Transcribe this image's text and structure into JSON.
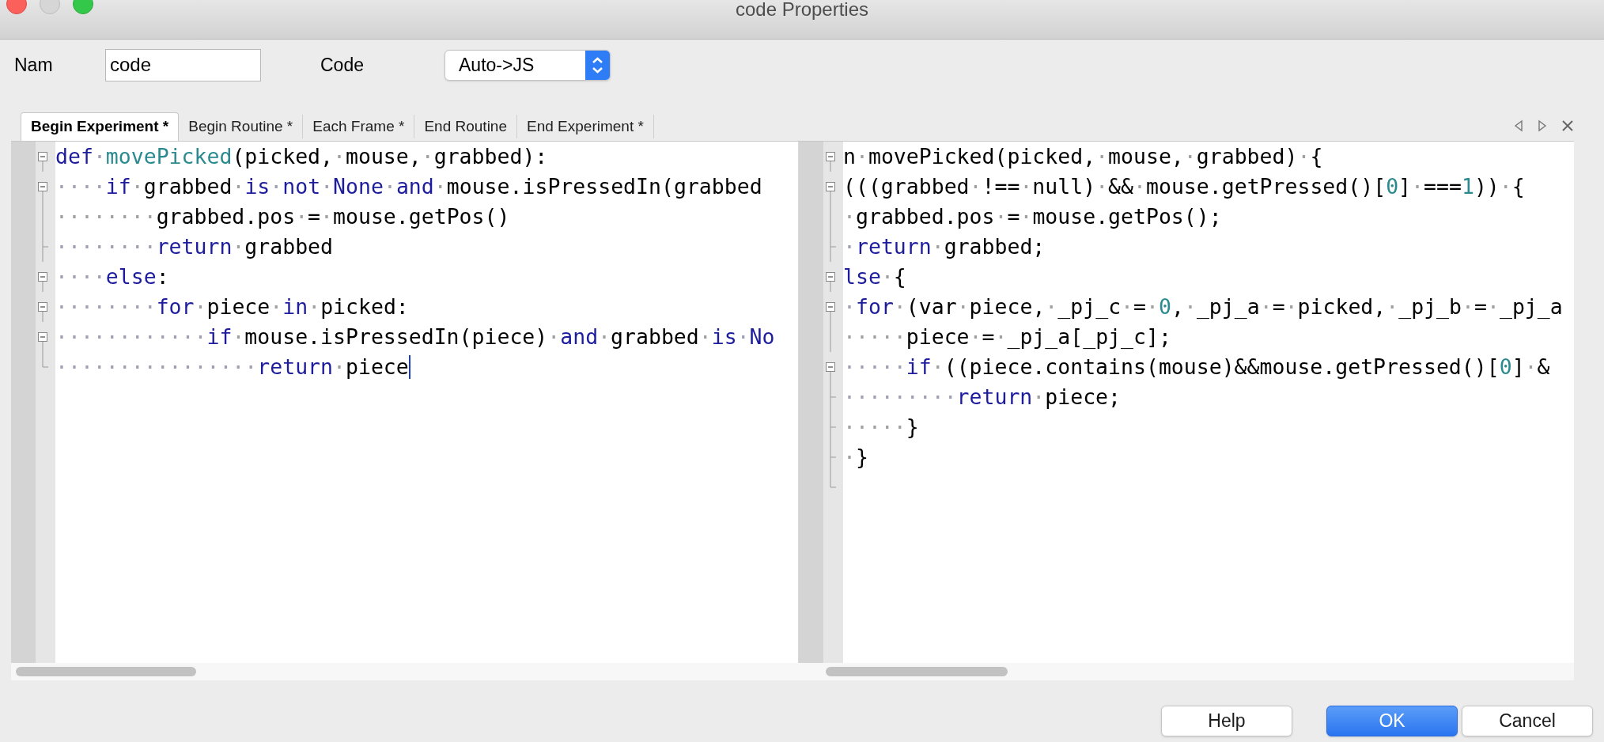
{
  "window": {
    "title": "code Properties"
  },
  "name_field": {
    "label": "Nam",
    "value": "code"
  },
  "code_type": {
    "label": "Code",
    "value": "Auto->JS"
  },
  "tabs": [
    {
      "label": "Begin Experiment *",
      "selected": true
    },
    {
      "label": "Begin Routine *",
      "selected": false
    },
    {
      "label": "Each Frame *",
      "selected": false
    },
    {
      "label": "End Routine",
      "selected": false
    },
    {
      "label": "End Experiment *",
      "selected": false
    }
  ],
  "editors": [
    {
      "lines": [
        {
          "kind": "fold-start",
          "caret": false,
          "tokens": [
            {
              "kind": "kw",
              "text": "def·"
            },
            {
              "kind": "fn",
              "text": "movePicked"
            },
            {
              "kind": "txt",
              "text": "(picked,·mouse,·grabbed):"
            }
          ]
        },
        {
          "kind": "fold-start",
          "caret": false,
          "tokens": [
            {
              "kind": "kw",
              "text": "····if"
            },
            {
              "kind": "txt",
              "text": "·grabbed·"
            },
            {
              "kind": "kw",
              "text": "is·not·None·and"
            },
            {
              "kind": "txt",
              "text": "·mouse.isPressedIn(grabbed"
            }
          ]
        },
        {
          "kind": "fold-body",
          "caret": false,
          "tokens": [
            {
              "kind": "txt",
              "text": "········grabbed.pos·=·mouse.getPos()"
            }
          ]
        },
        {
          "kind": "fold-tick",
          "caret": false,
          "tokens": [
            {
              "kind": "kw",
              "text": "········return"
            },
            {
              "kind": "txt",
              "text": "·grabbed"
            }
          ]
        },
        {
          "kind": "fold-start",
          "caret": false,
          "tokens": [
            {
              "kind": "kw",
              "text": "····else"
            },
            {
              "kind": "txt",
              "text": ":"
            }
          ]
        },
        {
          "kind": "fold-start",
          "caret": false,
          "tokens": [
            {
              "kind": "kw",
              "text": "········for"
            },
            {
              "kind": "txt",
              "text": "·piece·"
            },
            {
              "kind": "kw",
              "text": "in"
            },
            {
              "kind": "txt",
              "text": "·picked:"
            }
          ]
        },
        {
          "kind": "fold-start",
          "caret": false,
          "tokens": [
            {
              "kind": "kw",
              "text": "············if"
            },
            {
              "kind": "txt",
              "text": "·mouse.isPressedIn(piece)·"
            },
            {
              "kind": "kw",
              "text": "and"
            },
            {
              "kind": "txt",
              "text": "·grabbed·"
            },
            {
              "kind": "kw",
              "text": "is·No"
            }
          ]
        },
        {
          "kind": "fold-end",
          "caret": true,
          "tokens": [
            {
              "kind": "kw",
              "text": "················return"
            },
            {
              "kind": "txt",
              "text": "·piece"
            }
          ]
        }
      ]
    },
    {
      "lines": [
        {
          "kind": "fold-start",
          "tokens": [
            {
              "kind": "txt",
              "text": "n·movePicked(picked,·mouse,·grabbed)·{"
            }
          ]
        },
        {
          "kind": "fold-start",
          "tokens": [
            {
              "kind": "txt",
              "text": "(((grabbed·!==·null)·&&·mouse.getPressed()["
            },
            {
              "kind": "num",
              "text": "0"
            },
            {
              "kind": "txt",
              "text": "]·==="
            },
            {
              "kind": "num",
              "text": "1"
            },
            {
              "kind": "txt",
              "text": "))·{"
            }
          ]
        },
        {
          "kind": "fold-body",
          "tokens": [
            {
              "kind": "txt",
              "text": "·grabbed.pos·=·mouse.getPos();"
            }
          ]
        },
        {
          "kind": "fold-tick",
          "tokens": [
            {
              "kind": "kw",
              "text": "·return"
            },
            {
              "kind": "txt",
              "text": "·grabbed;"
            }
          ]
        },
        {
          "kind": "fold-start",
          "tokens": [
            {
              "kind": "kw",
              "text": "lse"
            },
            {
              "kind": "txt",
              "text": "·{"
            }
          ]
        },
        {
          "kind": "fold-start",
          "tokens": [
            {
              "kind": "kw",
              "text": "·for"
            },
            {
              "kind": "txt",
              "text": "·(var·piece,·_pj_c·=·"
            },
            {
              "kind": "num",
              "text": "0"
            },
            {
              "kind": "txt",
              "text": ",·_pj_a·=·picked,·_pj_b·=·_pj_a"
            }
          ]
        },
        {
          "kind": "fold-body",
          "tokens": [
            {
              "kind": "txt",
              "text": "·····piece·=·_pj_a[_pj_c];"
            }
          ]
        },
        {
          "kind": "fold-start",
          "tokens": [
            {
              "kind": "kw",
              "text": "·····if"
            },
            {
              "kind": "txt",
              "text": "·((piece.contains(mouse)&&mouse.getPressed()["
            },
            {
              "kind": "num",
              "text": "0"
            },
            {
              "kind": "txt",
              "text": "]·&"
            }
          ]
        },
        {
          "kind": "fold-tick",
          "tokens": [
            {
              "kind": "kw",
              "text": "·········return"
            },
            {
              "kind": "txt",
              "text": "·piece;"
            }
          ]
        },
        {
          "kind": "fold-tick",
          "tokens": [
            {
              "kind": "txt",
              "text": "·····}"
            }
          ]
        },
        {
          "kind": "fold-tick",
          "tokens": [
            {
              "kind": "txt",
              "text": "·}"
            }
          ]
        },
        {
          "kind": "fold-end"
        }
      ]
    }
  ],
  "buttons": [
    {
      "label": "Help",
      "kind": "default"
    },
    {
      "label": "OK",
      "kind": "primary"
    },
    {
      "label": "Cancel",
      "kind": "default"
    }
  ]
}
